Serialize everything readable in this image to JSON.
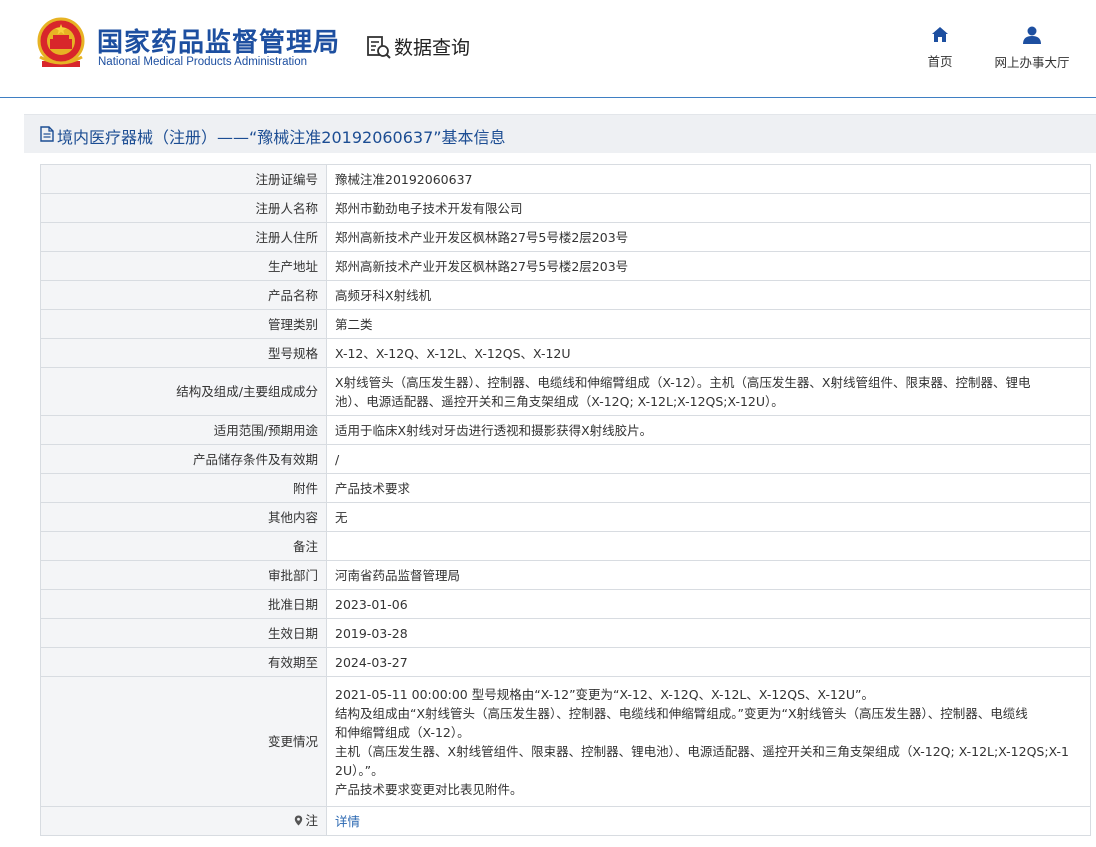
{
  "header": {
    "org_name_cn": "国家药品监督管理局",
    "org_name_en": "National Medical Products Administration",
    "data_query_label": "数据查询",
    "nav": [
      {
        "label": "首页",
        "icon": "home-icon"
      },
      {
        "label": "网上办事大厅",
        "icon": "user-icon"
      }
    ]
  },
  "title": "境内医疗器械（注册）——“豫械注准20192060637”基本信息",
  "rows": [
    {
      "label": "注册证编号",
      "value": "豫械注准20192060637"
    },
    {
      "label": "注册人名称",
      "value": "郑州市勤劲电子技术开发有限公司"
    },
    {
      "label": "注册人住所",
      "value": "郑州高新技术产业开发区枫林路27号5号楼2层203号"
    },
    {
      "label": "生产地址",
      "value": "郑州高新技术产业开发区枫林路27号5号楼2层203号"
    },
    {
      "label": "产品名称",
      "value": "高频牙科X射线机"
    },
    {
      "label": "管理类别",
      "value": "第二类"
    },
    {
      "label": "型号规格",
      "value": "X-12、X-12Q、X-12L、X-12QS、X-12U"
    },
    {
      "label": "结构及组成/主要组成成分",
      "lines": [
        "X射线管头（高压发生器）、控制器、电缆线和伸缩臂组成（X-12）。主机（高压发生器、X射线管组件、限束器、控制器、锂电",
        "池）、电源适配器、遥控开关和三角支架组成（X-12Q; X-12L;X-12QS;X-12U）。"
      ]
    },
    {
      "label": "适用范围/预期用途",
      "value": "适用于临床X射线对牙齿进行透视和摄影获得X射线胶片。"
    },
    {
      "label": "产品储存条件及有效期",
      "value": "/"
    },
    {
      "label": "附件",
      "value": "产品技术要求"
    },
    {
      "label": "其他内容",
      "value": "无"
    },
    {
      "label": "备注",
      "value": ""
    },
    {
      "label": "审批部门",
      "value": "河南省药品监督管理局"
    },
    {
      "label": "批准日期",
      "value": "2023-01-06"
    },
    {
      "label": "生效日期",
      "value": "2019-03-28"
    },
    {
      "label": "有效期至",
      "value": "2024-03-27"
    },
    {
      "label": "变更情况",
      "lines": [
        "2021-05-11 00:00:00 型号规格由“X-12”变更为“X-12、X-12Q、X-12L、X-12QS、X-12U”。",
        "结构及组成由“X射线管头（高压发生器）、控制器、电缆线和伸缩臂组成。”变更为“X射线管头（高压发生器）、控制器、电缆线",
        "和伸缩臂组成（X-12）。",
        "主机（高压发生器、X射线管组件、限束器、控制器、锂电池）、电源适配器、遥控开关和三角支架组成（X-12Q; X-12L;X-12QS;X-1",
        "2U）。”。",
        "产品技术要求变更对比表见附件。"
      ]
    },
    {
      "label": "注",
      "value": "详情",
      "note": true
    }
  ]
}
